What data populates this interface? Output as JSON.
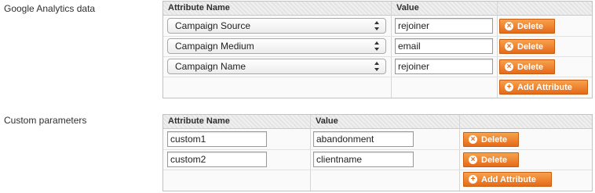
{
  "ga": {
    "label": "Google Analytics data",
    "col_name": "Attribute Name",
    "col_value": "Value",
    "rows": [
      {
        "name": "Campaign Source",
        "value": "rejoiner",
        "delete": "Delete"
      },
      {
        "name": "Campaign Medium",
        "value": "email",
        "delete": "Delete"
      },
      {
        "name": "Campaign Name",
        "value": "rejoiner",
        "delete": "Delete"
      }
    ],
    "add_label": "Add Attribute"
  },
  "custom": {
    "label": "Custom parameters",
    "col_name": "Attribute Name",
    "col_value": "Value",
    "rows": [
      {
        "name": "custom1",
        "value": "abandonment",
        "delete": "Delete"
      },
      {
        "name": "custom2",
        "value": "clientname",
        "delete": "Delete"
      }
    ],
    "add_label": "Add Attribute"
  },
  "icons": {
    "delete": "delete-circle-icon",
    "add": "plus-circle-icon",
    "select_arrows": "up-down-arrows-icon"
  },
  "colors": {
    "button": "#e66a19",
    "header": "#e9e9e9",
    "border": "#c2c2c2"
  }
}
